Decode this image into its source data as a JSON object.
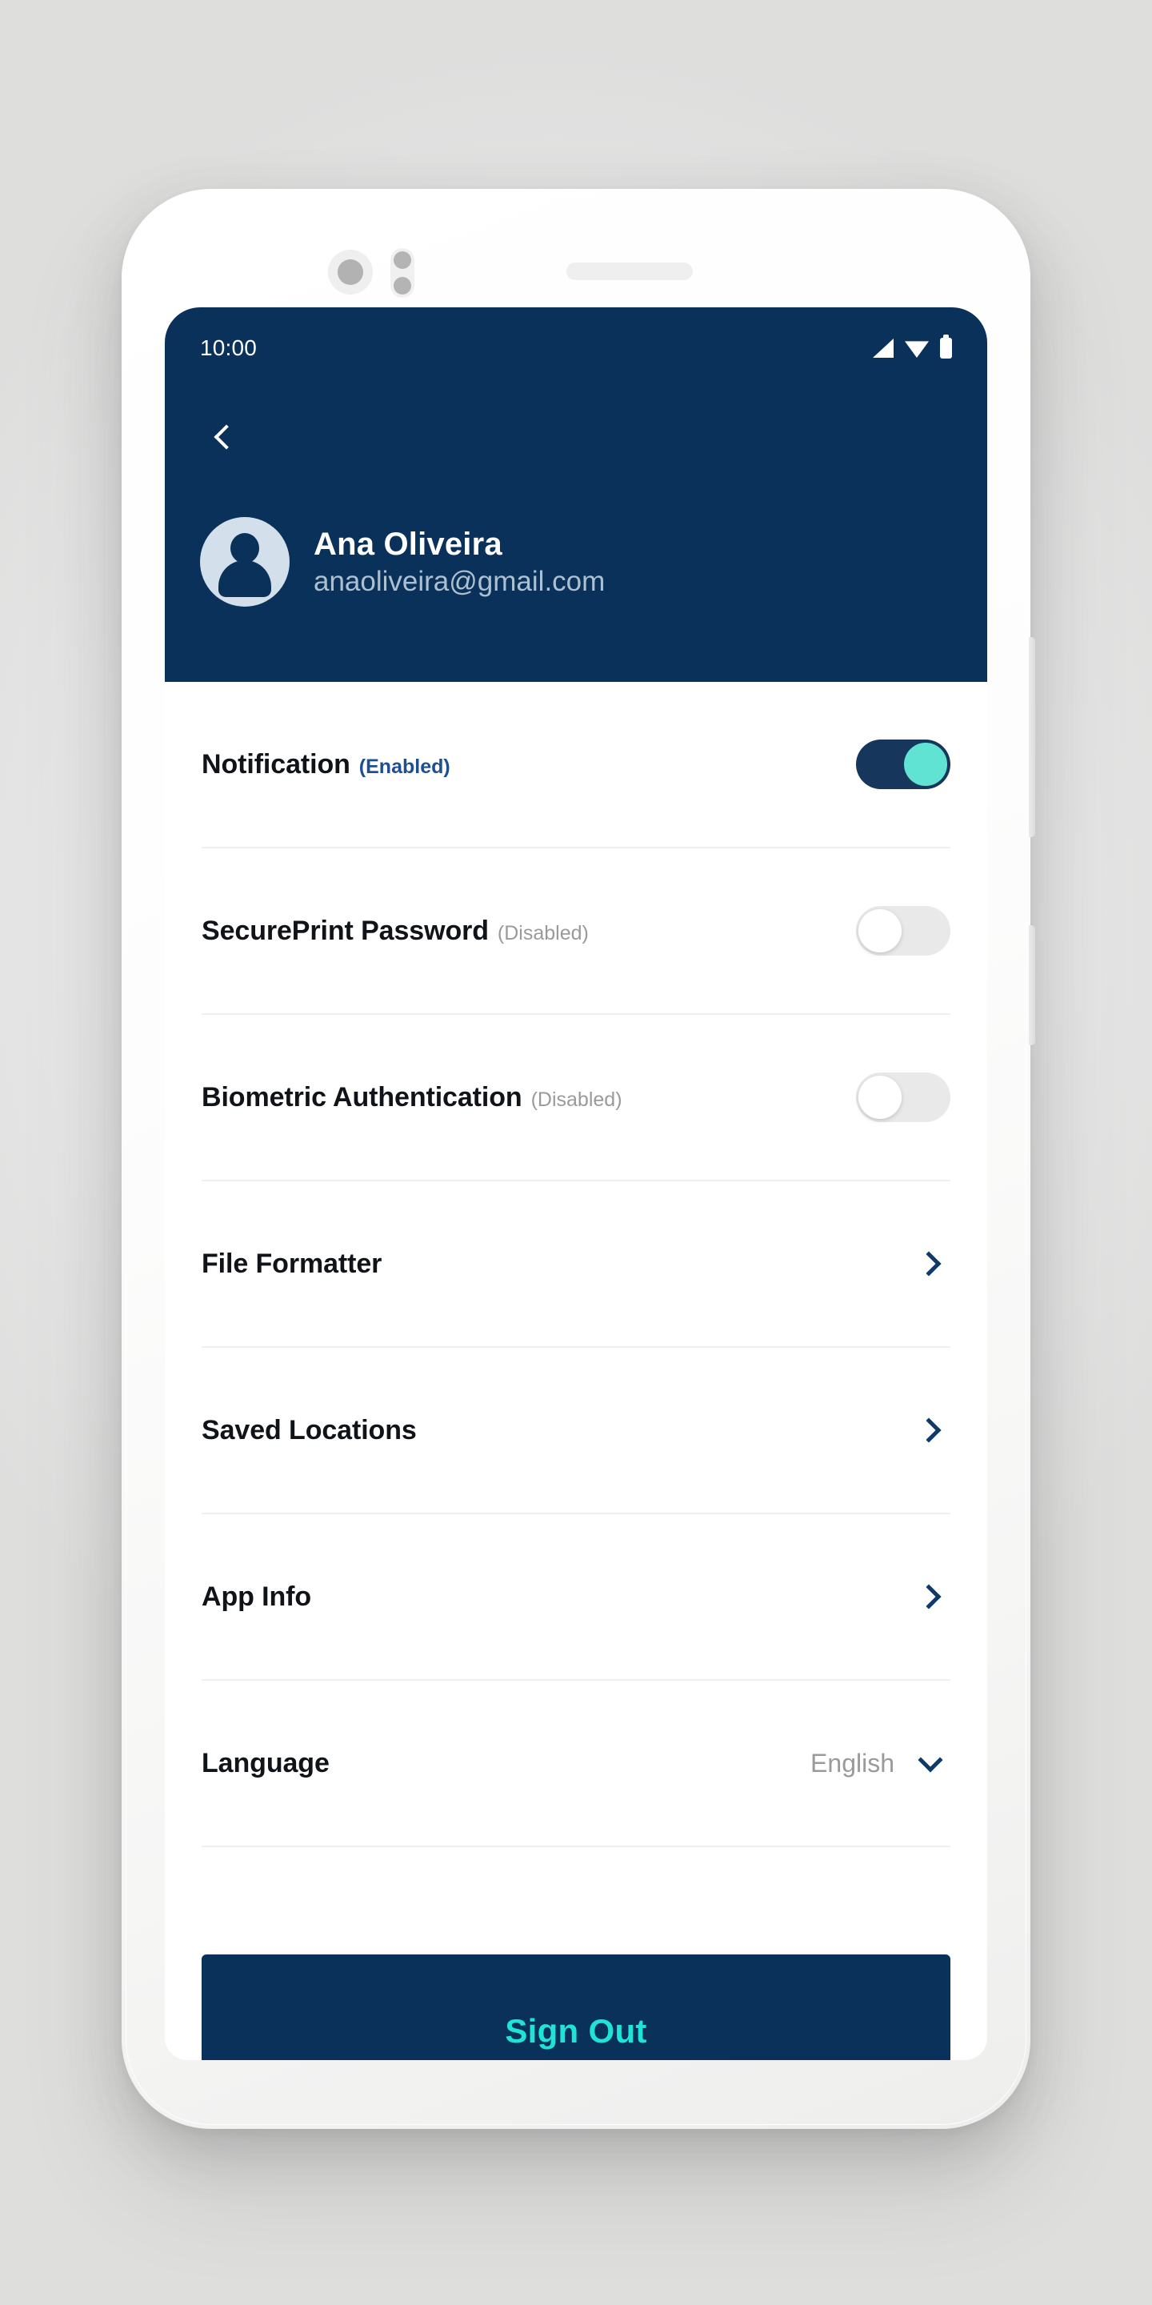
{
  "status_bar": {
    "time": "10:00",
    "icons": [
      "signal-icon",
      "wifi-icon",
      "battery-icon"
    ]
  },
  "header": {
    "back_icon": "chevron-left-icon",
    "avatar_icon": "user-avatar-icon",
    "name": "Ana Oliveira",
    "email": "anaoliveira@gmail.com",
    "background_color": "#0a3159"
  },
  "settings": {
    "rows": [
      {
        "title": "Notification",
        "state": "(Enabled)",
        "state_kind": "enabled",
        "control": "toggle",
        "toggle_on": true
      },
      {
        "title": "SecurePrint Password",
        "state": "(Disabled)",
        "state_kind": "disabled",
        "control": "toggle",
        "toggle_on": false
      },
      {
        "title": "Biometric Authentication",
        "state": "(Disabled)",
        "state_kind": "disabled",
        "control": "toggle",
        "toggle_on": false
      },
      {
        "title": "File Formatter",
        "state": "",
        "control": "chevron-right"
      },
      {
        "title": "Saved Locations",
        "state": "",
        "control": "chevron-right"
      },
      {
        "title": "App Info",
        "state": "",
        "control": "chevron-right"
      },
      {
        "title": "Language",
        "state": "",
        "control": "chevron-down",
        "value": "English"
      }
    ]
  },
  "footer": {
    "sign_out_label": "Sign Out",
    "sign_out_text_color": "#1fe3d8",
    "sign_out_bg_color": "#0a3159"
  },
  "theme": {
    "navy": "#0a3159",
    "teal": "#1fe3d8",
    "toggle_on_track": "#16365c",
    "toggle_on_knob": "#61e3d4",
    "toggle_off_track": "#e9e9e9",
    "divider": "#eef0f1"
  }
}
